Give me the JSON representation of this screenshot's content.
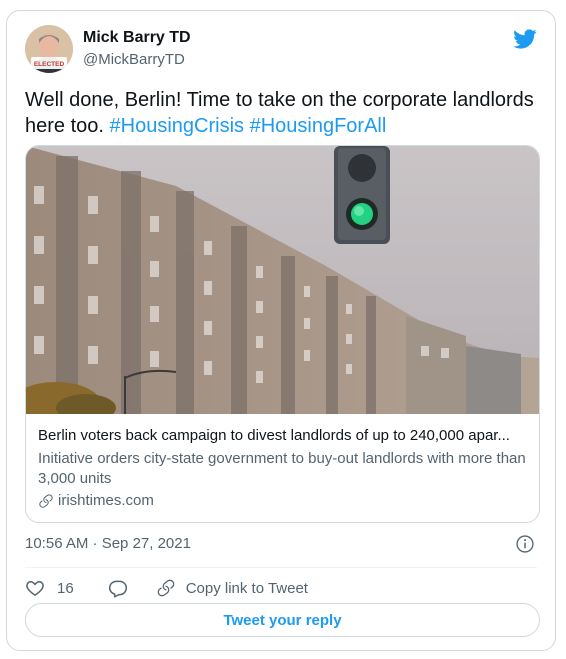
{
  "author": {
    "name": "Mick Barry TD",
    "handle": "@MickBarryTD",
    "avatar_badge": "ELECTED"
  },
  "tweet": {
    "text_before": "Well done, Berlin! Time to take on the corporate landlords here too. ",
    "hashtags": [
      "#HousingCrisis",
      "#HousingForAll"
    ]
  },
  "link_card": {
    "title": "Berlin voters back campaign to divest landlords of up to 240,000 apar...",
    "description": "Initiative orders city-state government to buy-out landlords with more than 3,000 units",
    "domain": "irishtimes.com"
  },
  "meta": {
    "timestamp": "10:56 AM · Sep 27, 2021"
  },
  "actions": {
    "like_count": "16",
    "copy_link_label": "Copy link to Tweet",
    "reply_button_label": "Tweet your reply"
  },
  "colors": {
    "accent": "#1d9bf0",
    "text": "#0f1419",
    "muted": "#536471",
    "border": "#cfd9de"
  },
  "icons": [
    "twitter-bird-icon",
    "link-icon",
    "info-icon",
    "heart-icon",
    "reply-icon",
    "copy-link-icon"
  ]
}
